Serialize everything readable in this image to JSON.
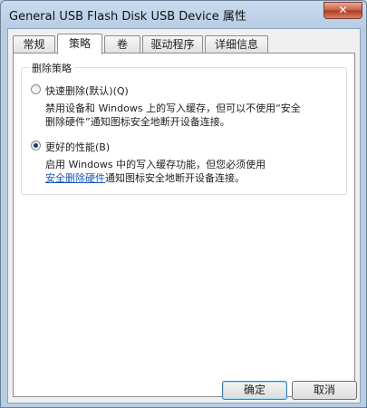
{
  "window": {
    "title": "General USB Flash Disk USB Device 属性",
    "close_glyph": "✕"
  },
  "tabs": [
    {
      "label": "常规",
      "active": false
    },
    {
      "label": "策略",
      "active": true
    },
    {
      "label": "卷",
      "active": false
    },
    {
      "label": "驱动程序",
      "active": false
    },
    {
      "label": "详细信息",
      "active": false
    }
  ],
  "group": {
    "title": "删除策略"
  },
  "options": {
    "quick": {
      "label": "快速删除(默认)(Q)",
      "checked": false,
      "desc_line1": "禁用设备和 Windows 上的写入缓存，但可以不使用“安全",
      "desc_line2": "删除硬件”通知图标安全地断开设备连接。"
    },
    "better": {
      "label": "更好的性能(B)",
      "checked": true,
      "desc_line1": "启用 Windows 中的写入缓存功能，但您必须使用",
      "desc_link": "安全删除硬件",
      "desc_line2_rest": "通知图标安全地断开设备连接。"
    }
  },
  "buttons": {
    "ok": "确定",
    "cancel": "取消"
  }
}
